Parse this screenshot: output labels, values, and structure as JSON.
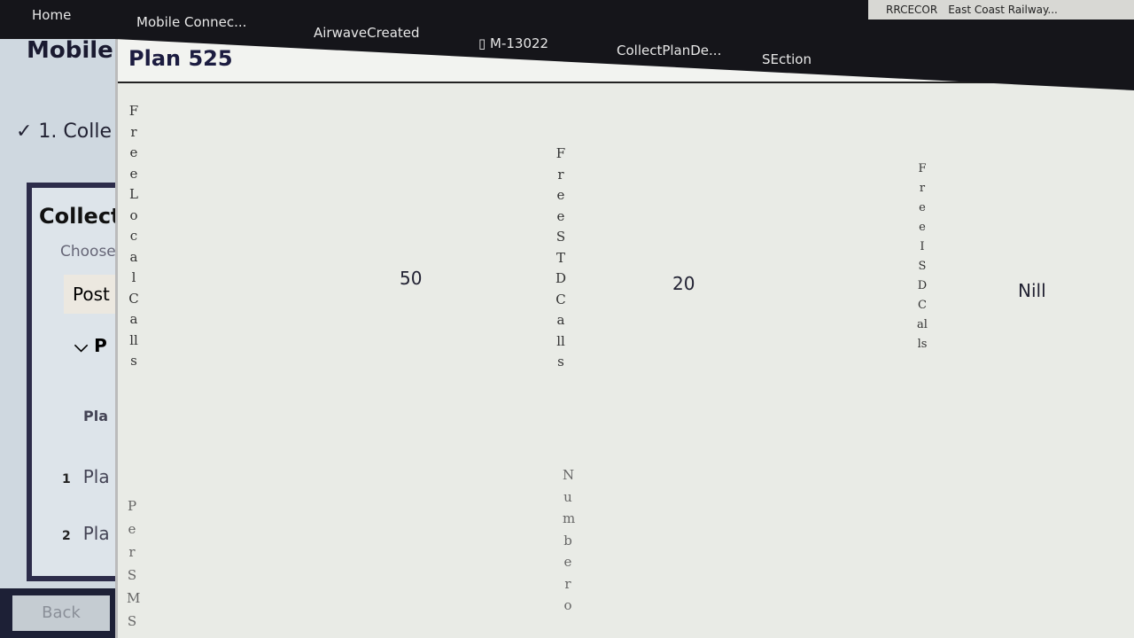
{
  "topbar": {
    "tabs": [
      "Home",
      "Mobile Connec...",
      "AirwaveCreated",
      "M-13022",
      "CollectPlanDe...",
      "SEction"
    ],
    "right": [
      "RRCECOR",
      "East Coast Railway..."
    ]
  },
  "background": {
    "title": "Mobile",
    "step": "✓ 1. Colle",
    "card_title": "Collect",
    "choose": "Choose",
    "post": "Post",
    "section": "⌵ P",
    "plan_header": "Pla",
    "rows": [
      {
        "n": "1",
        "label": "Pla"
      },
      {
        "n": "2",
        "label": "Pla"
      }
    ],
    "back": "Back"
  },
  "modal": {
    "title": "Plan 525",
    "fields": [
      {
        "label": "FreeLocalCalls",
        "value": "50"
      },
      {
        "label": "FreeSTDCalls",
        "value": "20"
      },
      {
        "label": "FreeISDCalls",
        "value": "Nill"
      },
      {
        "label": "PerSMS",
        "value": ""
      },
      {
        "label": "Numbero",
        "value": ""
      }
    ]
  },
  "bottom_icons": [
    "warning-icon",
    "share-icon",
    "clipboard-icon",
    "comment-icon"
  ]
}
